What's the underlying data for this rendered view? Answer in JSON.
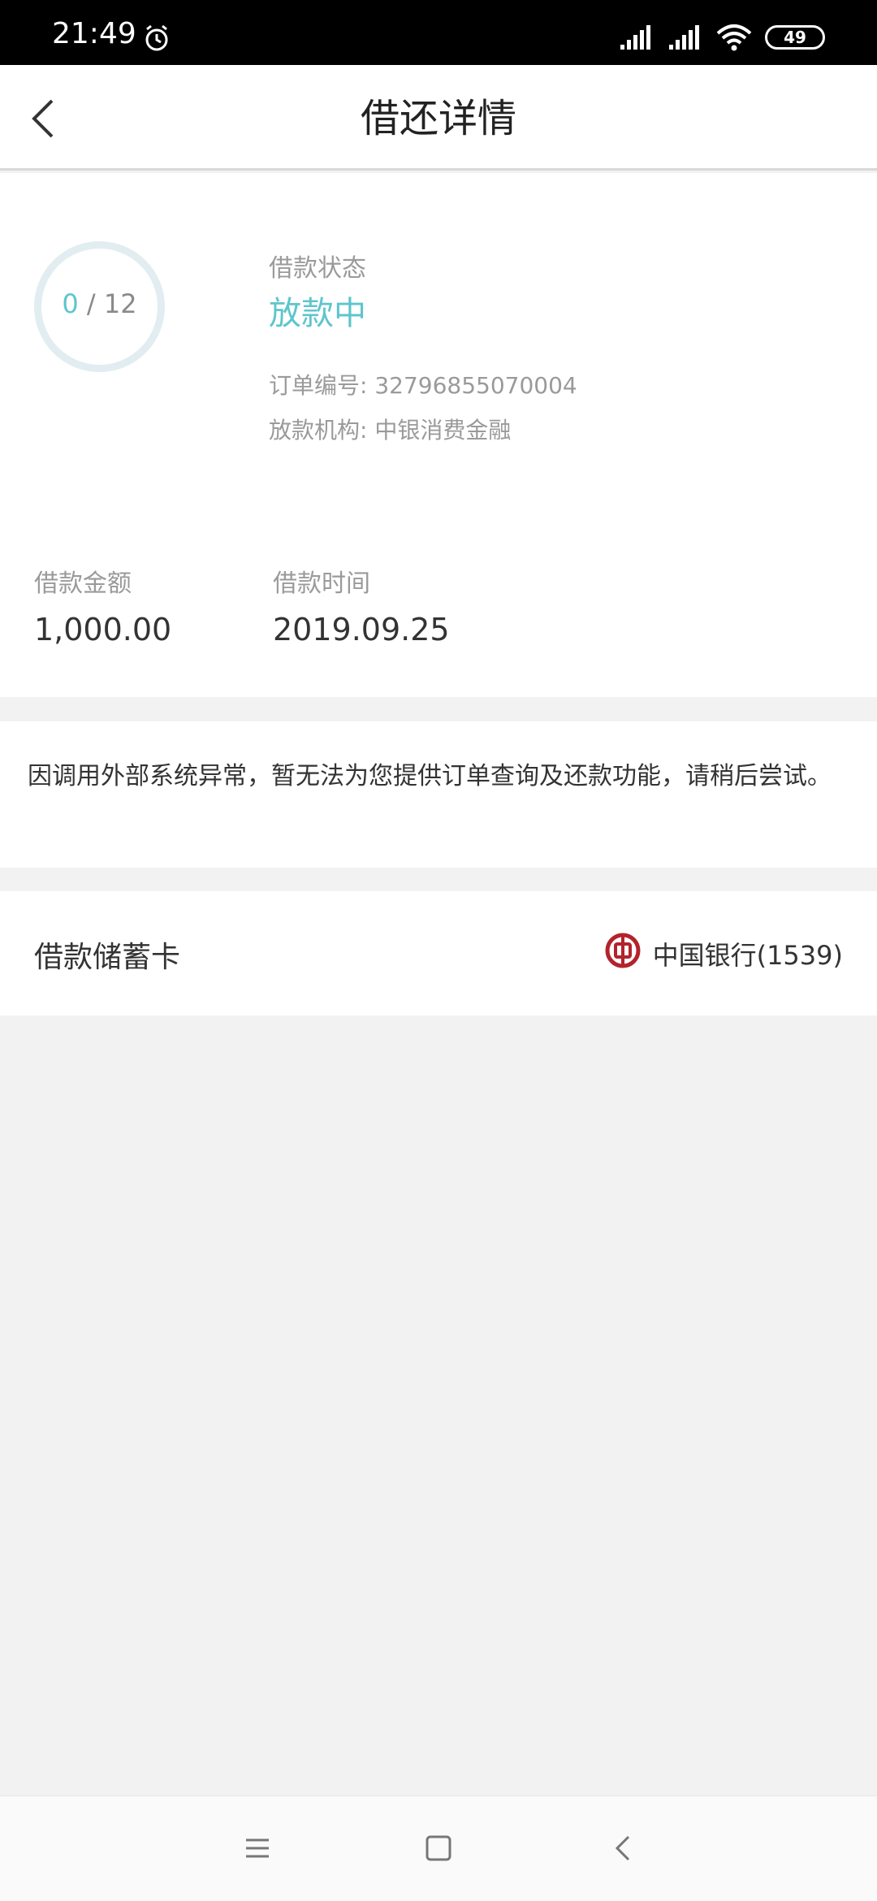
{
  "status_bar": {
    "time": "21:49",
    "battery": "49"
  },
  "header": {
    "title": "借还详情"
  },
  "loan": {
    "progress_current": "0",
    "progress_sep": " / ",
    "progress_total": "12",
    "progress_ratio": 0,
    "status_label": "借款状态",
    "status_value": "放款中",
    "order_no": "订单编号: 32796855070004",
    "lender": "放款机构: 中银消费金融",
    "amount_label": "借款金额",
    "amount_value": "1,000.00",
    "time_label": "借款时间",
    "time_value": "2019.09.25"
  },
  "notice": {
    "text": "因调用外部系统异常，暂无法为您提供订单查询及还款功能，请稍后尝试。"
  },
  "debit_card": {
    "label": "借款储蓄卡",
    "bank": "中国银行(1539)",
    "bank_icon": "boc-logo-icon"
  },
  "colors": {
    "accent": "#5ec5cc",
    "bank_red": "#b3232b"
  }
}
